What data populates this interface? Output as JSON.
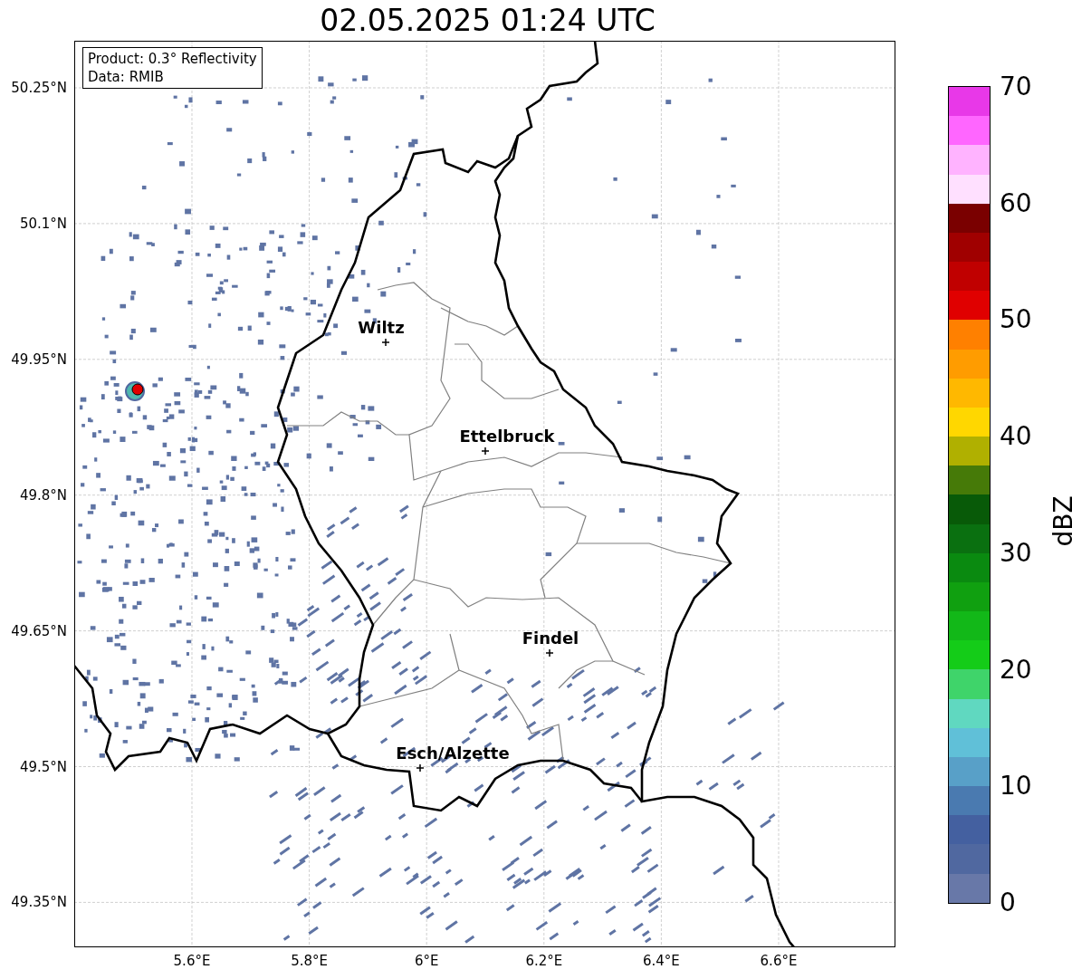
{
  "title": "02.05.2025 01:24 UTC",
  "info_box": {
    "lines": [
      "Product: 0.3° Reflectivity",
      "Data: RMIB"
    ]
  },
  "map": {
    "xticks": [
      "5.6°E",
      "5.8°E",
      "6°E",
      "6.2°E",
      "6.4°E",
      "6.6°E"
    ],
    "yticks": [
      "50.25°N",
      "50.1°N",
      "49.95°N",
      "49.8°N",
      "49.65°N",
      "49.5°N",
      "49.35°N"
    ],
    "cities": [
      {
        "name": "Wiltz"
      },
      {
        "name": "Ettelbruck"
      },
      {
        "name": "Findel"
      },
      {
        "name": "Esch/Alzette"
      }
    ]
  },
  "colorbar": {
    "label": "dBZ",
    "ticks": [
      "70",
      "60",
      "50",
      "40",
      "30",
      "20",
      "10",
      "0"
    ],
    "segments": [
      {
        "color": "#e838e8"
      },
      {
        "color": "#ff66ff"
      },
      {
        "color": "#ffb3ff"
      },
      {
        "color": "#ffe0ff"
      },
      {
        "color": "#7a0000"
      },
      {
        "color": "#a00000"
      },
      {
        "color": "#c00000"
      },
      {
        "color": "#e00000"
      },
      {
        "color": "#ff8000"
      },
      {
        "color": "#ff9c00"
      },
      {
        "color": "#ffb800"
      },
      {
        "color": "#ffd700"
      },
      {
        "color": "#b0b000"
      },
      {
        "color": "#467a08"
      },
      {
        "color": "#085a08"
      },
      {
        "color": "#0a7010"
      },
      {
        "color": "#0a8a10"
      },
      {
        "color": "#10a010"
      },
      {
        "color": "#12b818"
      },
      {
        "color": "#14cc18"
      },
      {
        "color": "#3fd46a"
      },
      {
        "color": "#60d8c0"
      },
      {
        "color": "#60c0d8"
      },
      {
        "color": "#58a0c8"
      },
      {
        "color": "#4a7ab0"
      },
      {
        "color": "#4460a0"
      },
      {
        "color": "#5068a0"
      },
      {
        "color": "#6878a8"
      }
    ]
  }
}
